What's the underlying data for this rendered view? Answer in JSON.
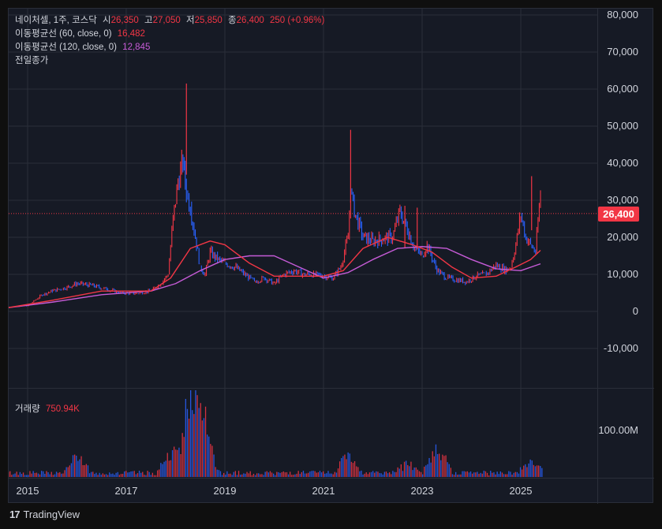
{
  "legend": {
    "symbol": "네이처셀, 1주, 코스닥",
    "open_label": "시",
    "open": "26,350",
    "high_label": "고",
    "high": "27,050",
    "low_label": "저",
    "low": "25,850",
    "close_label": "종",
    "close": "26,400",
    "change": "250 (+0.96%)",
    "ma60_label": "이동평균선 (60, close, 0)",
    "ma60_value": "16,482",
    "ma120_label": "이동평균선 (120, close, 0)",
    "ma120_value": "12,845",
    "prev_close_label": "전일종가",
    "volume_label": "거래량",
    "volume_value": "750.94K"
  },
  "colors": {
    "up": "#f23645",
    "down": "#2962ff",
    "ma60": "#f23645",
    "ma120": "#c65bd7",
    "background": "#161a25",
    "grid": "#2a2e39"
  },
  "last_price_tag": "26,400",
  "brand": {
    "logo": "17",
    "name": "TradingView"
  },
  "chart_data": {
    "type": "line",
    "y_axis_ticks": [
      "80,000",
      "70,000",
      "60,000",
      "50,000",
      "40,000",
      "30,000",
      "20,000",
      "10,000",
      "0",
      "-10,000"
    ],
    "ylim": [
      -20000,
      80000
    ],
    "x_axis_ticks": [
      "2015",
      "2017",
      "2019",
      "2021",
      "2023",
      "2025"
    ],
    "volume_axis_ticks": [
      "100.00M"
    ],
    "last_close": 26400,
    "price": {
      "x": [
        2014.6,
        2015.0,
        2015.3,
        2015.5,
        2015.8,
        2016.0,
        2016.3,
        2016.6,
        2016.9,
        2017.2,
        2017.5,
        2017.7,
        2017.85,
        2017.95,
        2018.05,
        2018.15,
        2018.22,
        2018.3,
        2018.4,
        2018.5,
        2018.6,
        2018.7,
        2018.85,
        2019.0,
        2019.2,
        2019.4,
        2019.6,
        2019.8,
        2020.0,
        2020.2,
        2020.4,
        2020.6,
        2020.8,
        2021.0,
        2021.2,
        2021.35,
        2021.5,
        2021.55,
        2021.65,
        2021.8,
        2022.0,
        2022.2,
        2022.4,
        2022.55,
        2022.7,
        2022.85,
        2023.0,
        2023.1,
        2023.3,
        2023.5,
        2023.7,
        2023.9,
        2024.1,
        2024.3,
        2024.5,
        2024.7,
        2024.8,
        2024.9,
        2025.0,
        2025.1,
        2025.2,
        2025.3,
        2025.4
      ],
      "y": [
        1200,
        1500,
        4500,
        5500,
        6500,
        7500,
        7000,
        6000,
        5000,
        4800,
        5500,
        7500,
        10000,
        25000,
        35000,
        40000,
        32000,
        28000,
        20000,
        12000,
        10000,
        16000,
        14000,
        13000,
        12000,
        10000,
        8000,
        9000,
        7500,
        10000,
        11000,
        10000,
        10000,
        9500,
        9000,
        12000,
        20000,
        32000,
        26000,
        20000,
        19000,
        19500,
        20000,
        27000,
        22000,
        17000,
        15000,
        18000,
        11000,
        9000,
        8500,
        8000,
        9500,
        10000,
        12500,
        11000,
        12000,
        18000,
        26000,
        20000,
        18000,
        16000,
        32000,
        26400
      ],
      "note": "approximate closing-price trace"
    },
    "ma60": {
      "x": [
        2014.6,
        2015.5,
        2016.5,
        2017.5,
        2017.9,
        2018.3,
        2018.7,
        2019.0,
        2019.5,
        2020.0,
        2020.5,
        2021.0,
        2021.4,
        2021.8,
        2022.3,
        2022.8,
        2023.2,
        2023.6,
        2024.0,
        2024.5,
        2024.9,
        2025.2,
        2025.4
      ],
      "y": [
        1000,
        3000,
        5500,
        5500,
        9000,
        17000,
        19000,
        18000,
        13000,
        9500,
        9500,
        9500,
        11000,
        17000,
        20000,
        18000,
        16000,
        12000,
        9000,
        9500,
        12000,
        14000,
        16482
      ]
    },
    "ma120": {
      "x": [
        2014.6,
        2015.5,
        2016.5,
        2017.5,
        2018.0,
        2018.5,
        2019.0,
        2019.5,
        2020.0,
        2020.5,
        2021.0,
        2021.5,
        2022.0,
        2022.5,
        2023.0,
        2023.5,
        2024.0,
        2024.5,
        2025.0,
        2025.4
      ],
      "y": [
        1000,
        2500,
        4500,
        5500,
        7500,
        11000,
        14000,
        15000,
        15000,
        12000,
        9000,
        10500,
        14000,
        17000,
        17500,
        17000,
        14000,
        11500,
        11000,
        12845
      ]
    },
    "volume_peaks": {
      "x": [
        2016.0,
        2017.9,
        2018.2,
        2018.4,
        2018.6,
        2021.5,
        2022.7,
        2023.3,
        2025.2
      ],
      "y": [
        30,
        35,
        70,
        100,
        60,
        35,
        20,
        55,
        20
      ]
    }
  }
}
